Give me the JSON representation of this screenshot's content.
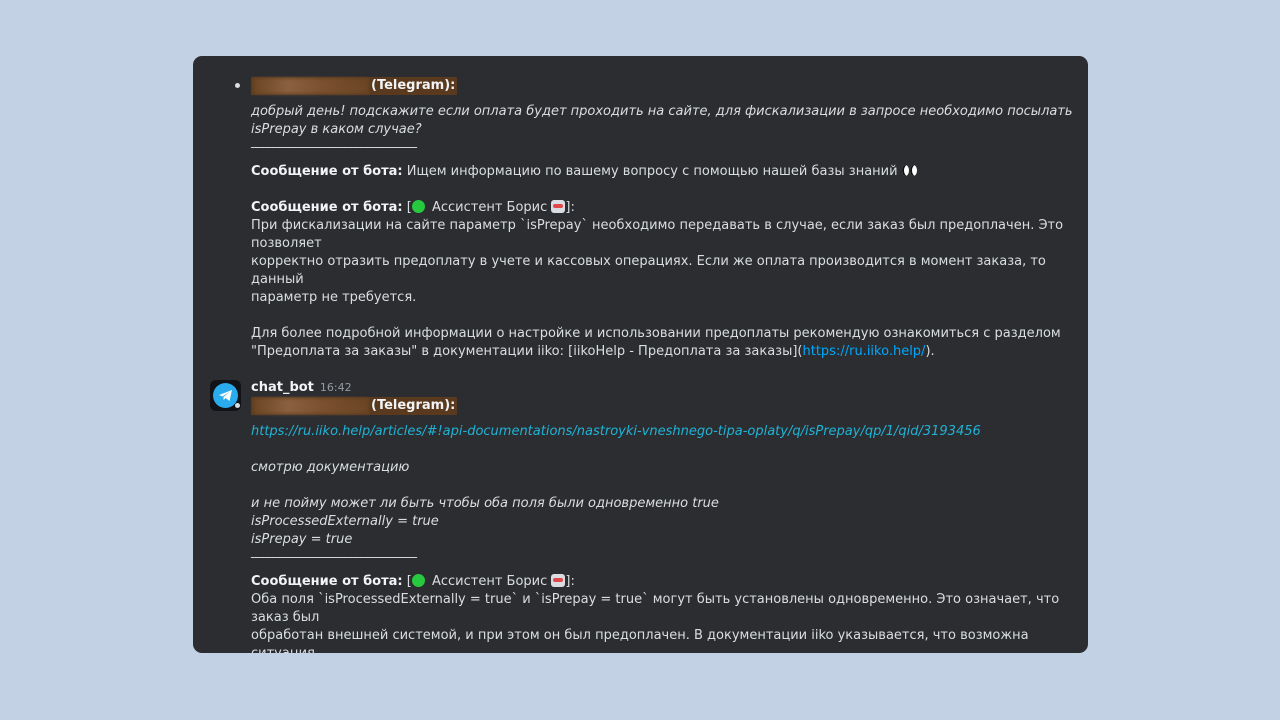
{
  "msg1": {
    "sender_tag": "(Telegram):",
    "text": "добрый день! подскажите если оплата будет проходить на сайте, для фискализации в запросе необходимо посылать\nisPrepay в каком случае?",
    "divider": "______________________________",
    "bot1_label": "Сообщение от бота:",
    "bot1_text": " Ищем информацию по вашему вопросу с помощью нашей базы знаний ",
    "bot2_label": "Сообщение от бота:",
    "bot2_open": " [",
    "assistant_name": " Ассистент Борис ",
    "bot2_close": "]:",
    "bot2_text": "При фискализации на сайте параметр `isPrepay` необходимо передавать в случае, если заказ был предоплачен. Это позволяет\nкорректно отразить предоплату в учете и кассовых операциях. Если же оплата производится в момент заказа, то данный\nпараметр не требуется.",
    "bot2_text2_pre": "Для более подробной информации о настройке и использовании предоплаты рекомендую ознакомиться с разделом\n\"Предоплата за заказы\" в документации iiko: [iikoHelp - Предоплата за заказы](",
    "bot2_link": "https://ru.iiko.help/",
    "bot2_text2_post": ")."
  },
  "msg2": {
    "author": "chat_bot",
    "time": "16:42",
    "sender_tag": "(Telegram):",
    "link": "https://ru.iiko.help/articles/#!api-documentations/nastroyki-vneshnego-tipa-oplaty/q/isPrepay/qp/1/qid/3193456",
    "line1": "смотрю документацию",
    "line2": "и не пойму может ли быть чтобы оба поля были одновременно true",
    "line3": "isProcessedExternally = true",
    "line4": "isPrepay = true",
    "divider": "______________________________",
    "bot_label": "Сообщение от бота:",
    "bot_open": " [",
    "assistant_name": " Ассистент Борис ",
    "bot_close": "]:",
    "bot_text": "Оба поля `isProcessedExternally = true` и `isPrepay = true` могут быть установлены одновременно. Это означает, что заказ был\nобработан внешней системой, и при этом он был предоплачен. В документации iiko указывается, что возможна ситуация,\nкогда внешняя система обрабатывает заказы и при этом включает предоплату за них."
  }
}
